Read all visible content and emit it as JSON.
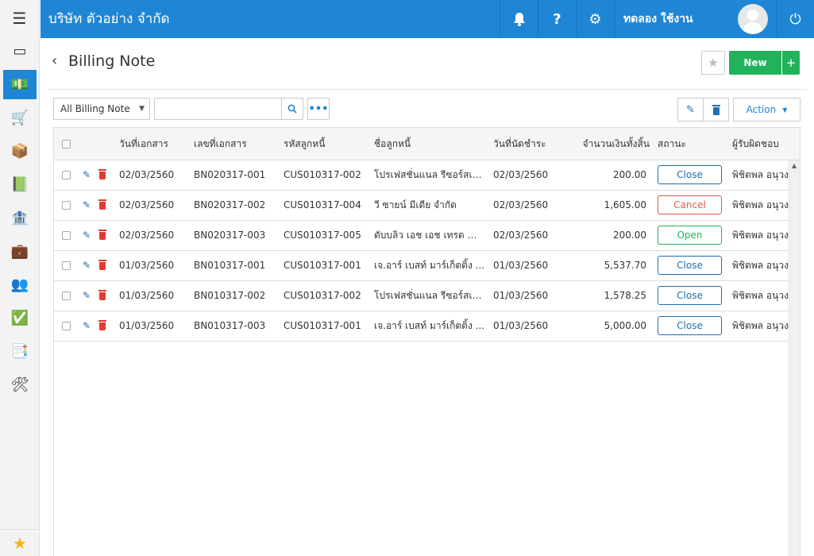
{
  "app": {
    "company_name": "บริษัท ตัวอย่าง จำกัด",
    "user_name": "ทดลอง ใช้งาน"
  },
  "rail": {
    "items": [
      {
        "icon": "dashboard-icon",
        "glyph": "▭",
        "active": false
      },
      {
        "icon": "money-icon",
        "glyph": "💵",
        "active": true
      },
      {
        "icon": "cart-icon",
        "glyph": "🛒",
        "active": false
      },
      {
        "icon": "box-icon",
        "glyph": "📦",
        "active": false
      },
      {
        "icon": "book-icon",
        "glyph": "📗",
        "active": false
      },
      {
        "icon": "bank-icon",
        "glyph": "🏦",
        "active": false
      },
      {
        "icon": "wallet-icon",
        "glyph": "💼",
        "active": false
      },
      {
        "icon": "people-icon",
        "glyph": "👥",
        "active": false
      },
      {
        "icon": "check-circle-icon",
        "glyph": "✅",
        "active": false
      },
      {
        "icon": "report-icon",
        "glyph": "📑",
        "active": false
      },
      {
        "icon": "tools-icon",
        "glyph": "🛠",
        "active": false
      }
    ]
  },
  "page": {
    "title": "Billing Note",
    "new_label": "New",
    "new_plus": "+"
  },
  "toolbar": {
    "filter_value": "All Billing Note",
    "search_placeholder": "",
    "action_label": "Action"
  },
  "table": {
    "columns": {
      "doc_date": "วันที่เอกสาร",
      "doc_no": "เลขที่เอกสาร",
      "customer_code": "รหัสลูกหนี้",
      "customer_name": "ชื่อลูกหนี้",
      "due_date": "วันที่นัดชำระ",
      "total": "จำนวนเงินทั้งสิ้น",
      "status": "สถานะ",
      "owner": "ผู้รับผิดชอบ"
    },
    "rows": [
      {
        "doc_date": "02/03/2560",
        "doc_no": "BN020317-001",
        "customer_code": "CUS010317-002",
        "customer_name": "โปรเฟสชั่นแนล รีซอร์สเซ...",
        "due_date": "02/03/2560",
        "total": "200.00",
        "status": "Close",
        "owner": "พิชิตพล อนุวง"
      },
      {
        "doc_date": "02/03/2560",
        "doc_no": "BN020317-002",
        "customer_code": "CUS010317-004",
        "customer_name": "วี ซายน์ มีเดีย จำกัด",
        "due_date": "02/03/2560",
        "total": "1,605.00",
        "status": "Cancel",
        "owner": "พิชิตพล อนุวง"
      },
      {
        "doc_date": "02/03/2560",
        "doc_no": "BN020317-003",
        "customer_code": "CUS010317-005",
        "customer_name": "ดับบลิว เอช เอช เทรด จำ...",
        "due_date": "02/03/2560",
        "total": "200.00",
        "status": "Open",
        "owner": "พิชิตพล อนุวง"
      },
      {
        "doc_date": "01/03/2560",
        "doc_no": "BN010317-001",
        "customer_code": "CUS010317-001",
        "customer_name": "เจ.อาร์ เบสท์ มาร์เก็ตติ้ง ...",
        "due_date": "01/03/2560",
        "total": "5,537.70",
        "status": "Close",
        "owner": "พิชิตพล อนุวง"
      },
      {
        "doc_date": "01/03/2560",
        "doc_no": "BN010317-002",
        "customer_code": "CUS010317-002",
        "customer_name": "โปรเฟสชั่นแนล รีซอร์สเซ...",
        "due_date": "01/03/2560",
        "total": "1,578.25",
        "status": "Close",
        "owner": "พิชิตพล อนุวง"
      },
      {
        "doc_date": "01/03/2560",
        "doc_no": "BN010317-003",
        "customer_code": "CUS010317-001",
        "customer_name": "เจ.อาร์ เบสท์ มาร์เก็ตติ้ง ...",
        "due_date": "01/03/2560",
        "total": "5,000.00",
        "status": "Close",
        "owner": "พิชิตพล อนุวง"
      }
    ]
  },
  "colors": {
    "brand": "#1f86d6",
    "new_button": "#21b25c",
    "status_close": "#1f6fb2",
    "status_cancel": "#e05a47",
    "status_open": "#21b25c",
    "delete_icon": "#e53935"
  }
}
